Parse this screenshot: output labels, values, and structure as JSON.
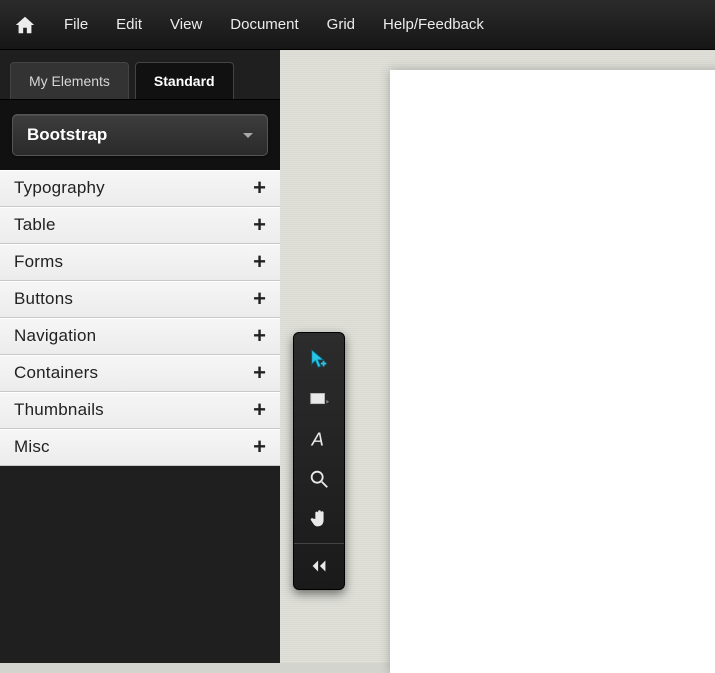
{
  "menubar": {
    "items": [
      "File",
      "Edit",
      "View",
      "Document",
      "Grid",
      "Help/Feedback"
    ]
  },
  "sidebar": {
    "tabs": [
      {
        "label": "My Elements",
        "active": false
      },
      {
        "label": "Standard",
        "active": true
      }
    ],
    "framework": "Bootstrap",
    "accordion": [
      "Typography",
      "Table",
      "Forms",
      "Buttons",
      "Navigation",
      "Containers",
      "Thumbnails",
      "Misc"
    ]
  },
  "vtoolbar": {
    "tools": [
      {
        "name": "select-move",
        "label": "Select/Move"
      },
      {
        "name": "rectangle",
        "label": "Rectangle"
      },
      {
        "name": "text",
        "label": "Text"
      },
      {
        "name": "zoom",
        "label": "Zoom"
      },
      {
        "name": "pan",
        "label": "Pan"
      },
      {
        "name": "collapse",
        "label": "Collapse"
      }
    ]
  }
}
